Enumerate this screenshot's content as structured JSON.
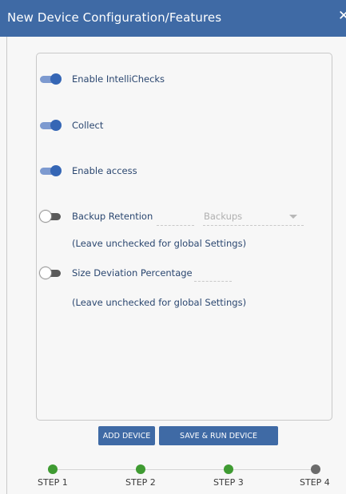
{
  "dialog": {
    "title": "New Device Configuration/Features",
    "close_glyph": "✕"
  },
  "features": {
    "enable_intellichecks": {
      "label": "Enable IntelliChecks",
      "enabled": true
    },
    "collect": {
      "label": "Collect",
      "enabled": true
    },
    "enable_access": {
      "label": "Enable access",
      "enabled": true
    },
    "backup_retention": {
      "label": "Backup Retention",
      "enabled": false,
      "value": "",
      "select_placeholder": "Backups",
      "note": "(Leave unchecked for global Settings)"
    },
    "size_deviation": {
      "label": "Size Deviation Percentage",
      "enabled": false,
      "value": "",
      "note": "(Leave unchecked for global Settings)"
    }
  },
  "actions": {
    "add_device": "ADD DEVICE",
    "save_run_device": "SAVE & RUN DEVICE"
  },
  "stepper": {
    "steps": [
      {
        "label": "STEP 1",
        "status": "complete"
      },
      {
        "label": "STEP 2",
        "status": "complete"
      },
      {
        "label": "STEP 3",
        "status": "complete"
      },
      {
        "label": "STEP 4",
        "status": "pending"
      }
    ]
  },
  "colors": {
    "header": "#3f6aa5",
    "toggle_on": "#3566b5",
    "step_complete": "#3f9b32",
    "step_pending": "#6b6b6b"
  },
  "icons": {
    "close": "close-icon",
    "select_caret": "chevron-down-icon"
  }
}
